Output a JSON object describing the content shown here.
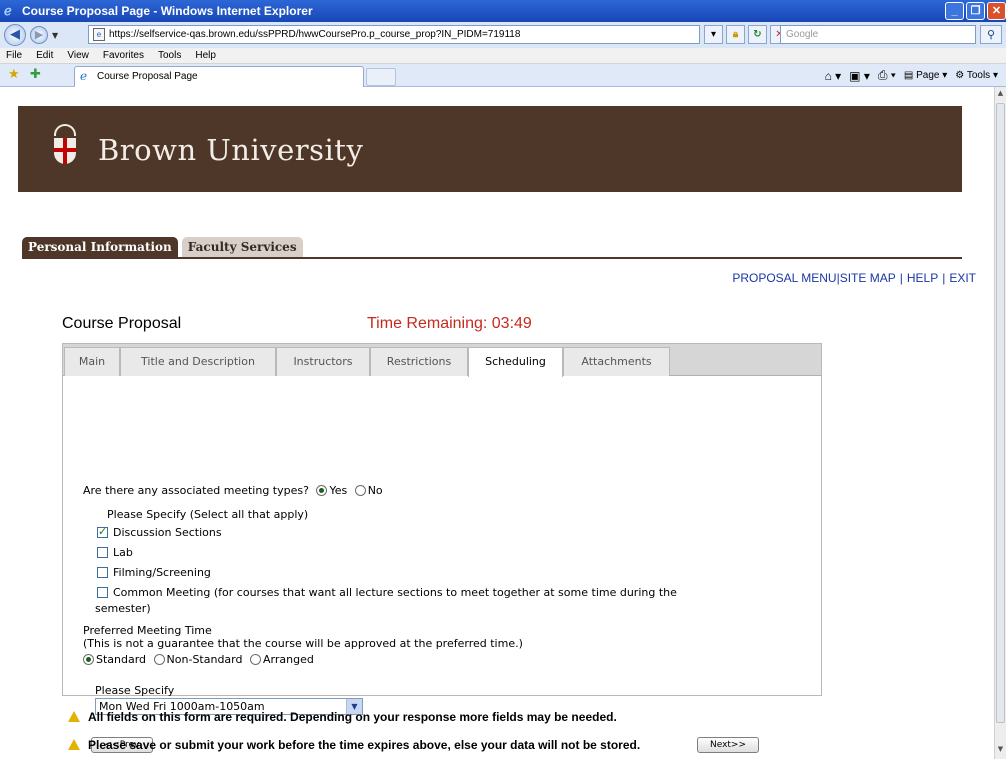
{
  "window": {
    "title": "Course Proposal Page - Windows Internet Explorer"
  },
  "address_bar": {
    "url": "https://selfservice-qas.brown.edu/ssPPRD/hwwCoursePro.p_course_prop?IN_PIDM=719118",
    "search_placeholder": "Google"
  },
  "menu": [
    "File",
    "Edit",
    "View",
    "Favorites",
    "Tools",
    "Help"
  ],
  "browser_tab": {
    "label": "Course Proposal Page"
  },
  "command_bar": {
    "page_label": "Page",
    "tools_label": "Tools"
  },
  "banner": {
    "university": "Brown University"
  },
  "portal_tabs": {
    "personal": "Personal Information",
    "faculty": "Faculty Services"
  },
  "top_links": {
    "proposal_menu": "PROPOSAL MENU",
    "site_map": "SITE MAP",
    "help": "HELP",
    "exit": "EXIT"
  },
  "form": {
    "title": "Course Proposal",
    "timer": "Time Remaining: 03:49",
    "tabs": [
      "Main",
      "Title and Description",
      "Instructors",
      "Restrictions",
      "Scheduling",
      "Attachments"
    ],
    "active_tab": "Scheduling",
    "meeting_question": "Are there any associated meeting types?",
    "yes_label": "Yes",
    "no_label": "No",
    "please_specify_select_all": "Please Specify (Select all that apply)",
    "options": {
      "discussion": "Discussion Sections",
      "lab": "Lab",
      "filming": "Filming/Screening",
      "common_line1": "Common Meeting (for courses that want all lecture sections to meet together at some time during the",
      "common_line2": "semester)"
    },
    "pref_title": "Preferred Meeting Time",
    "pref_note": "(This is not a guarantee that the course will be approved at the preferred time.)",
    "time_types": {
      "standard": "Standard",
      "non_standard": "Non-Standard",
      "arranged": "Arranged"
    },
    "please_specify": "Please Specify",
    "selected_time": "Mon Wed Fri 1000am-1050am",
    "prev_button": "<<Prev",
    "next_button": "Next>>"
  },
  "warnings": {
    "required": "All fields on this form are required. Depending on your response more fields may be needed.",
    "save": "Please save or submit your work before the time expires above, else your data will not be stored."
  }
}
